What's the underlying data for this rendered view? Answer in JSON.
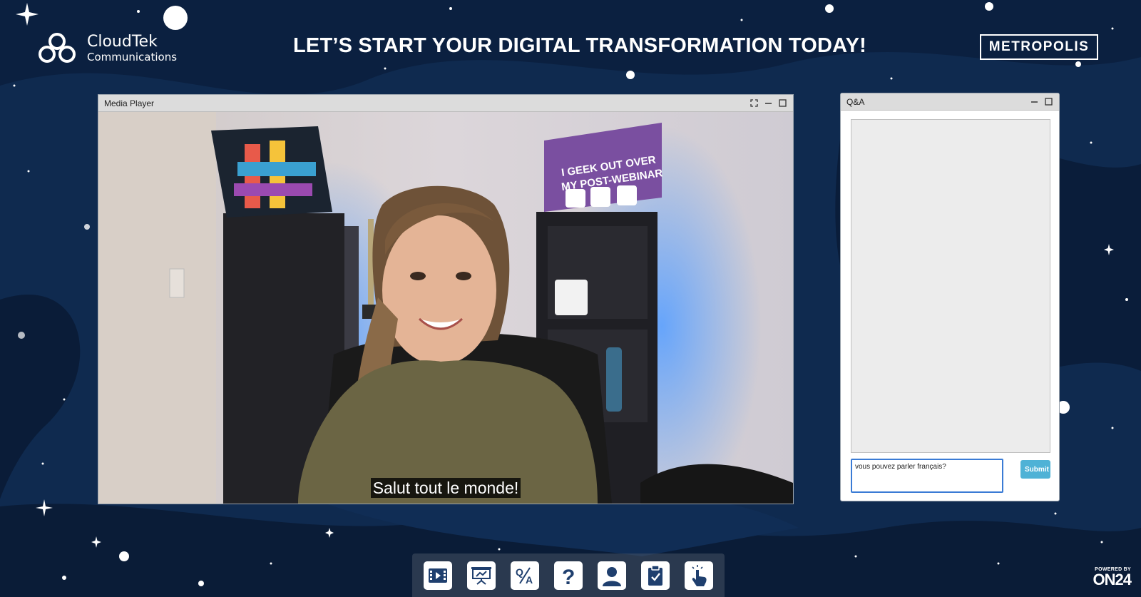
{
  "header": {
    "logo_line1": "CloudTek",
    "logo_line2": "Communications",
    "headline": "LET’S START YOUR DIGITAL TRANSFORMATION TODAY!",
    "brand_box": "METROPOLIS"
  },
  "media_player": {
    "title": "Media Player",
    "caption": "Salut tout le monde!"
  },
  "qa": {
    "title": "Q&A",
    "input_value": "vous pouvez parler français?",
    "submit_label": "Submit"
  },
  "dock": {
    "items": [
      "media-player-icon",
      "slides-icon",
      "qa-icon",
      "help-icon",
      "speaker-bio-icon",
      "survey-icon",
      "engagement-icon"
    ]
  },
  "footer": {
    "powered_by": "POWERED BY",
    "on24": "ON24"
  },
  "colors": {
    "background": "#0d2446",
    "accent": "#4fb2d6",
    "input_border": "#3a7bd5"
  }
}
